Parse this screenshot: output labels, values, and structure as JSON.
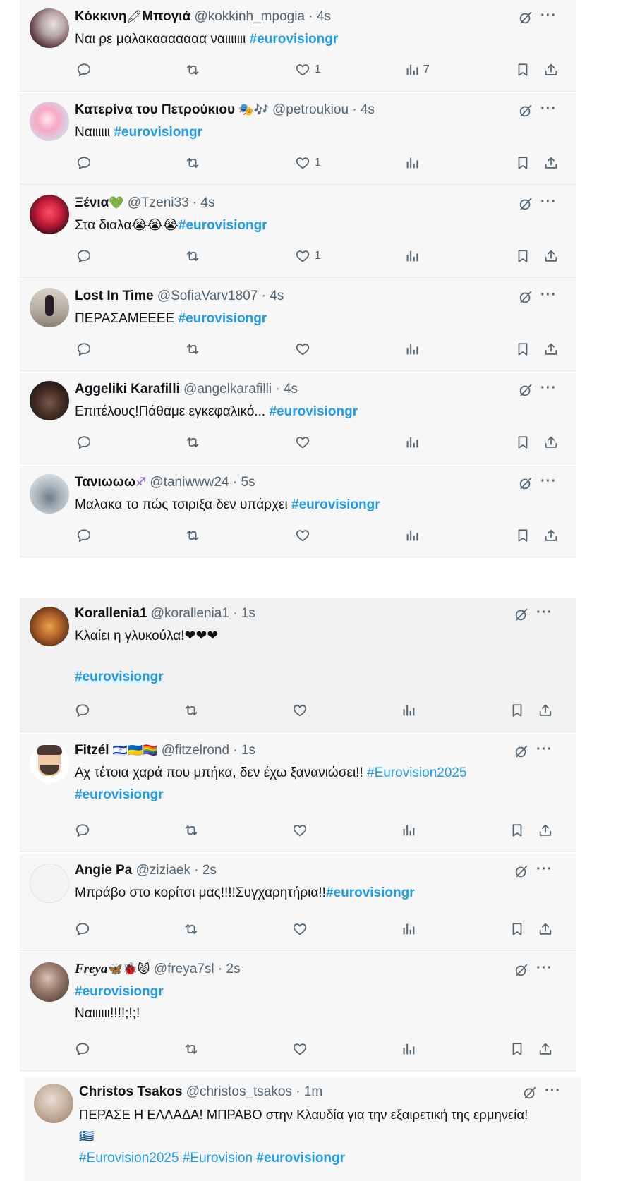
{
  "colors": {
    "link": "#1d9bf0",
    "text": "#0f1419",
    "muted": "#536471",
    "card_bg": "#f7f7f8"
  },
  "icons": [
    "reply-icon",
    "retweet-icon",
    "like-icon",
    "views-icon",
    "bookmark-icon",
    "share-icon",
    "grok-icon",
    "more-icon"
  ],
  "tweets": [
    {
      "name": "Κόκκινη",
      "name_emoji": "🖍",
      "name_suffix": "Μπογιά",
      "handle": "@kokkinh_mpogia",
      "time": "· 4s",
      "text": "Ναι ρε μαλακααααααα ναιιιιιιι ",
      "tag": "#eurovisiongr",
      "likes": "1",
      "views": "7"
    },
    {
      "name": "Κατερίνα του Πετρούκιου",
      "name_emoji": "🎭🎶",
      "handle": "@petroukiou",
      "time": "· 4s",
      "text": "Ναιιιιιι ",
      "tag": "#eurovisiongr",
      "likes": "1",
      "views": ""
    },
    {
      "name": "Ξένια",
      "name_emoji": "💚",
      "handle": "@Tzeni33",
      "time": "· 4s",
      "text": "Στα διαλα😭😭😭",
      "tag": "#eurovisiongr",
      "likes": "1",
      "views": ""
    },
    {
      "name": "Lost In Time",
      "name_emoji": "",
      "handle": "@SofiaVarv1807",
      "time": "· 4s",
      "text": "ΠΕΡΑΣΑΜΕΕΕΕ ",
      "tag": "#eurovisiongr",
      "likes": "",
      "views": ""
    },
    {
      "name": "Aggeliki Karafilli",
      "name_emoji": "",
      "handle": "@angelkarafilli",
      "time": "· 4s",
      "text": "Επιτέλους!Πάθαμε εγκεφαλικό... ",
      "tag": "#eurovisiongr",
      "likes": "",
      "views": ""
    },
    {
      "name": "Τανιωωω",
      "name_emoji": "♐",
      "handle": "@taniwww24",
      "time": "· 5s",
      "text": "Μαλακα το πώς τσιριξα δεν υπάρχει ",
      "tag": "#eurovisiongr",
      "likes": "",
      "views": ""
    },
    {
      "name": "Korallenia1",
      "name_emoji": "",
      "handle": "@korallenia1",
      "time": "· 1s",
      "text": "Κλαίει η γλυκούλα!❤❤❤",
      "tag": "#eurovisiongr",
      "likes": "",
      "views": ""
    },
    {
      "name": "Fitzél",
      "name_emoji": "🇮🇱🇺🇦🏳‍🌈",
      "handle": "@fitzelrond",
      "time": "· 1s",
      "text": "Αχ τέτοια χαρά που μπήκα, δεν έχω ξανανιώσει!! ",
      "tag2": "#Eurovision2025",
      "tag": "#eurovisiongr",
      "likes": "",
      "views": ""
    },
    {
      "name": "Angie Pa",
      "name_emoji": "",
      "handle": "@ziziaek",
      "time": "· 2s",
      "text": "Μπράβο στο κορίτσι μας!!!!Συγχαρητήρια!!",
      "tag": "#eurovisiongr",
      "likes": "",
      "views": ""
    },
    {
      "name": "Freya",
      "name_emoji": "🦋🐞😾",
      "handle": "@freya7sl",
      "time": "· 2s",
      "tag": "#eurovisiongr",
      "text": "Ναιιιιιι!!!!;!;!",
      "likes": "",
      "views": ""
    },
    {
      "name": "Christos Tsakos",
      "name_emoji": "",
      "handle": "@christos_tsakos",
      "time": "· 1m",
      "text": "ΠΕΡΑΣΕ Η ΕΛΛΑΔΑ! ΜΠΡΑΒΟ στην Κλαυδία για την εξαιρετική της ερμηνεία!",
      "flag": "🇬🇷",
      "tag3": "#Eurovision2025",
      "tag4": "#Eurovision",
      "tag": "#eurovisiongr",
      "likes": "",
      "views": ""
    }
  ]
}
